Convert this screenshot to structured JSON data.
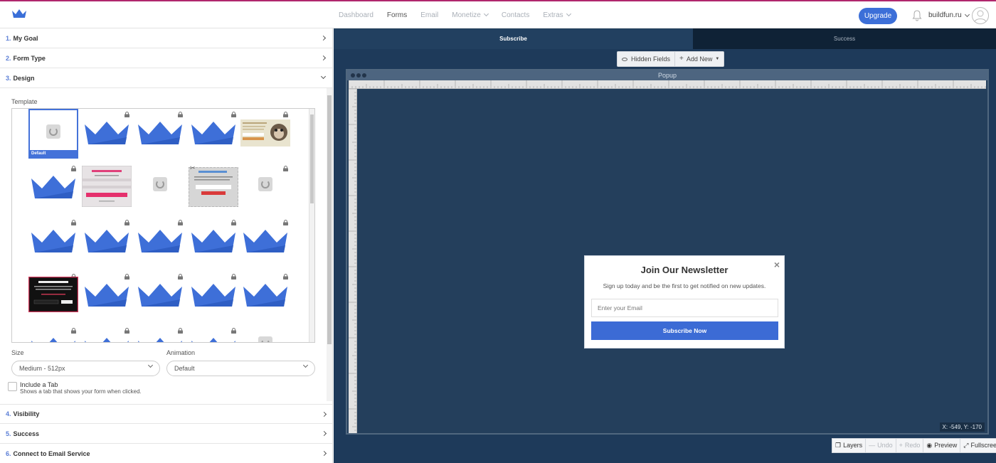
{
  "nav": {
    "items": [
      {
        "label": "Dashboard",
        "active": false,
        "dropdown": false
      },
      {
        "label": "Forms",
        "active": true,
        "dropdown": false
      },
      {
        "label": "Email",
        "active": false,
        "dropdown": false
      },
      {
        "label": "Monetize",
        "active": false,
        "dropdown": true
      },
      {
        "label": "Contacts",
        "active": false,
        "dropdown": false
      },
      {
        "label": "Extras",
        "active": false,
        "dropdown": true
      }
    ],
    "upgrade_label": "Upgrade",
    "account_name": "buildfun.ru"
  },
  "sidebar": {
    "sections": [
      {
        "num": "1.",
        "label": "My Goal"
      },
      {
        "num": "2.",
        "label": "Form Type"
      },
      {
        "num": "3.",
        "label": "Design"
      },
      {
        "num": "4.",
        "label": "Visibility"
      },
      {
        "num": "5.",
        "label": "Success"
      },
      {
        "num": "6.",
        "label": "Connect to Email Service"
      }
    ],
    "template_label": "Template",
    "default_badge": "Default",
    "size_label": "Size",
    "size_value": "Medium - 512px",
    "animation_label": "Animation",
    "animation_value": "Default",
    "include_tab_title": "Include a Tab",
    "include_tab_desc": "Shows a tab that shows your form when clicked."
  },
  "workspace": {
    "tabs": [
      {
        "label": "Subscribe",
        "active": true
      },
      {
        "label": "Success",
        "active": false
      }
    ],
    "hidden_fields_label": "Hidden Fields",
    "add_new_label": "Add New",
    "canvas_title": "Popup",
    "coords": "X: -549, Y: -170",
    "popup": {
      "title": "Join Our Newsletter",
      "close": "×",
      "subtitle": "Sign up today and be the first to get notified on new updates.",
      "email_placeholder": "Enter your Email",
      "button_label": "Subscribe Now"
    },
    "bottom_tools": [
      {
        "label": "Layers",
        "enabled": true,
        "icon": "layers-icon"
      },
      {
        "label": "Undo",
        "enabled": false,
        "icon": "minus-icon"
      },
      {
        "label": "Redo",
        "enabled": false,
        "icon": "plus-icon"
      },
      {
        "label": "Preview",
        "enabled": true,
        "icon": "eye-icon"
      },
      {
        "label": "Fullscreen",
        "enabled": true,
        "icon": "expand-icon"
      }
    ]
  },
  "colors": {
    "accent": "#3c6fd8",
    "topbar_border": "#b0276d",
    "workspace_bg": "#1e3a5a"
  }
}
